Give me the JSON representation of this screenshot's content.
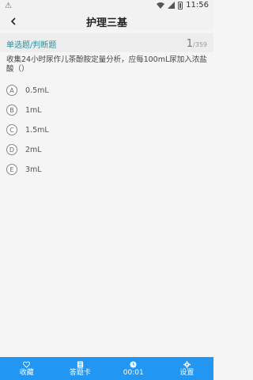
{
  "status_bar": {
    "notification_icon": "alert-icon",
    "time": "11:56"
  },
  "header": {
    "title": "护理三基"
  },
  "question": {
    "type": "单选题/判断题",
    "current": "1",
    "total": "/359",
    "text": "收集24小时尿作儿茶酚胺定量分析，应每100mL尿加入浓盐酸（）",
    "options": [
      {
        "letter": "A",
        "text": "0.5mL"
      },
      {
        "letter": "B",
        "text": "1mL"
      },
      {
        "letter": "C",
        "text": "1.5mL"
      },
      {
        "letter": "D",
        "text": "2mL"
      },
      {
        "letter": "E",
        "text": "3mL"
      }
    ]
  },
  "bottom_bar": {
    "tabs": [
      {
        "label": "收藏",
        "icon": "heart-icon"
      },
      {
        "label": "答题卡",
        "icon": "answer-card-icon"
      },
      {
        "label": "00:01",
        "icon": "timer-icon"
      },
      {
        "label": "设置",
        "icon": "gear-icon"
      }
    ],
    "color": "#2196f3"
  }
}
